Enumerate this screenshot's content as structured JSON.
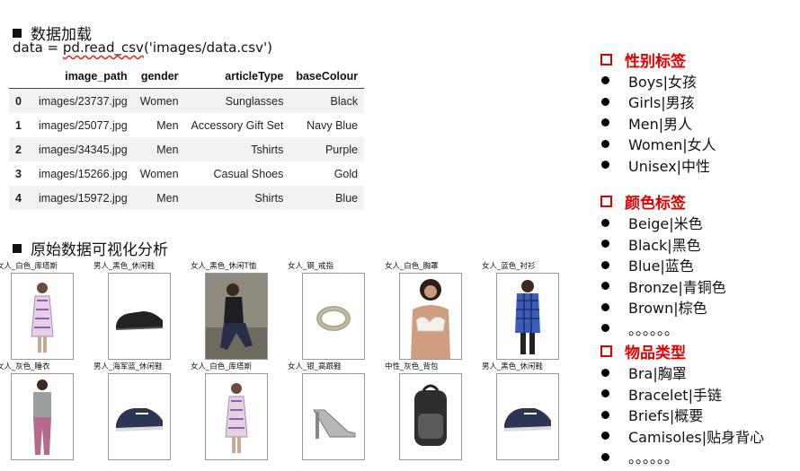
{
  "sections": {
    "load_title": "数据加载",
    "viz_title": "原始数据可视化分析"
  },
  "code": {
    "prefix": "data = ",
    "squiggle": "pd.read_csv",
    "suffix": "('images/data.csv')"
  },
  "table": {
    "columns": [
      "",
      "image_path",
      "gender",
      "articleType",
      "baseColour"
    ],
    "rows": [
      {
        "idx": "0",
        "image_path": "images/23737.jpg",
        "gender": "Women",
        "articleType": "Sunglasses",
        "baseColour": "Black"
      },
      {
        "idx": "1",
        "image_path": "images/25077.jpg",
        "gender": "Men",
        "articleType": "Accessory Gift Set",
        "baseColour": "Navy Blue"
      },
      {
        "idx": "2",
        "image_path": "images/34345.jpg",
        "gender": "Men",
        "articleType": "Tshirts",
        "baseColour": "Purple"
      },
      {
        "idx": "3",
        "image_path": "images/15266.jpg",
        "gender": "Women",
        "articleType": "Casual Shoes",
        "baseColour": "Gold"
      },
      {
        "idx": "4",
        "image_path": "images/15972.jpg",
        "gender": "Men",
        "articleType": "Shirts",
        "baseColour": "Blue"
      }
    ]
  },
  "gallery": [
    {
      "caption": "女人_白色_库塔斯",
      "icon": "kurta-icon"
    },
    {
      "caption": "男人_黑色_休闲鞋",
      "icon": "shoe-icon"
    },
    {
      "caption": "女人_黑色_休闲T恤",
      "icon": "tshirt-icon"
    },
    {
      "caption": "女人_钢_戒指",
      "icon": "ring-icon"
    },
    {
      "caption": "女人_白色_胸罩",
      "icon": "bra-icon"
    },
    {
      "caption": "女人_蓝色_衬衫",
      "icon": "shirt-icon"
    },
    {
      "caption": "女人_灰色_睡衣",
      "icon": "nightwear-icon"
    },
    {
      "caption": "男人_海军蓝_休闲鞋",
      "icon": "sneaker-icon"
    },
    {
      "caption": "女人_白色_库塔斯",
      "icon": "kurta-icon"
    },
    {
      "caption": "女人_银_高跟鞋",
      "icon": "heel-icon"
    },
    {
      "caption": "中性_灰色_背包",
      "icon": "backpack-icon"
    },
    {
      "caption": "男人_黑色_休闲鞋",
      "icon": "sneaker-icon"
    }
  ],
  "labels": {
    "gender": {
      "title": "性别标签",
      "items": [
        "Boys|女孩",
        "Girls|男孩",
        "Men|男人",
        "Women|女人",
        "Unisex|中性"
      ]
    },
    "color": {
      "title": "颜色标签",
      "items": [
        "Beige|米色",
        "Black|黑色",
        "Blue|蓝色",
        "Bronze|青铜色",
        "Brown|棕色",
        "。。。。。。"
      ]
    },
    "type": {
      "title": "物品类型",
      "items": [
        "Bra|胸罩",
        "Bracelet|手链",
        "Briefs|概要",
        "Camisoles|贴身背心",
        "。。。。。。"
      ]
    }
  },
  "colors": {
    "accent": "#e00000"
  }
}
